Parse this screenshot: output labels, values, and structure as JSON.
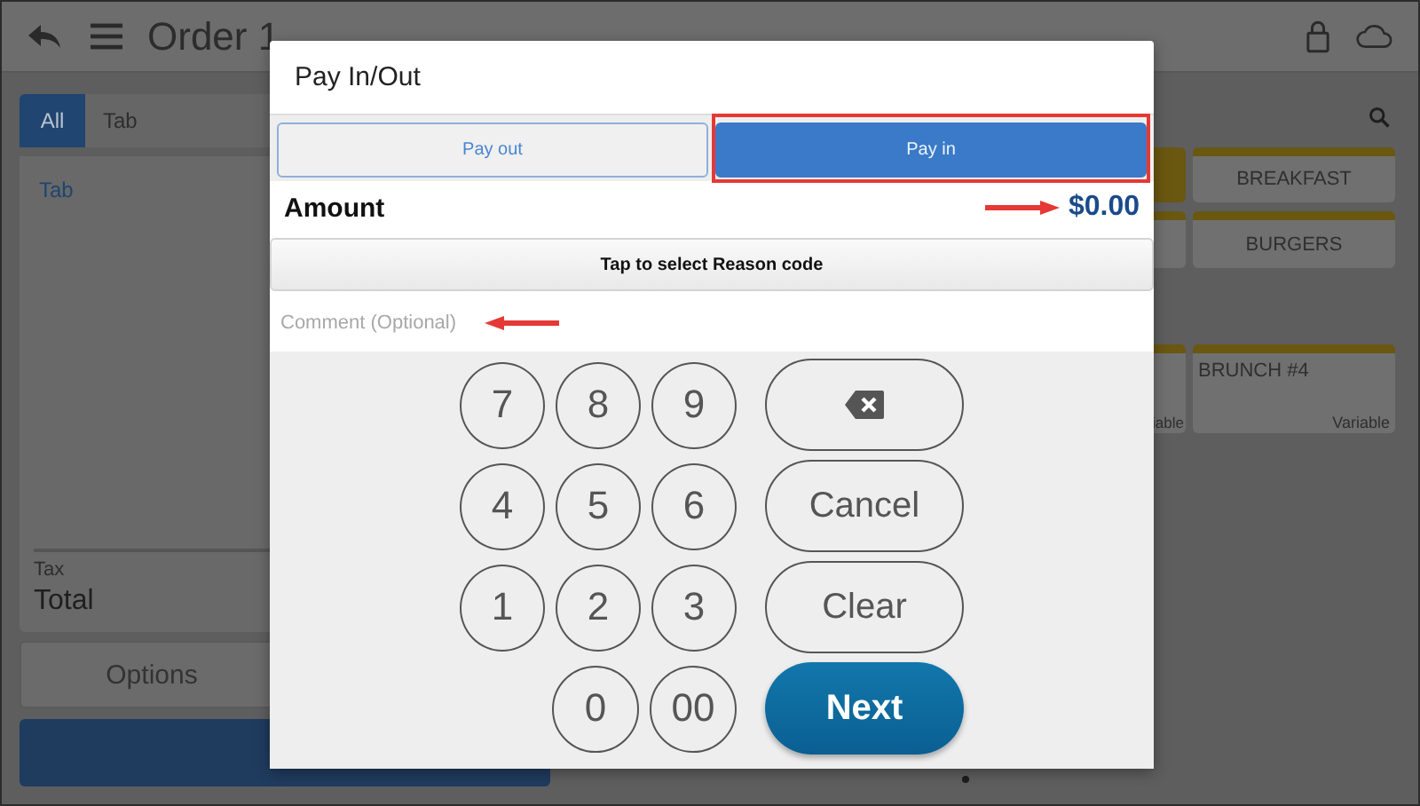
{
  "header": {
    "title": "Order 1"
  },
  "order_panel": {
    "tabs": [
      {
        "label": "All",
        "selected": true
      },
      {
        "label": "Tab",
        "selected": false
      }
    ],
    "items": [
      "Tab"
    ],
    "tax_label": "Tax",
    "total_label": "Total",
    "options_button": "Options"
  },
  "menu_tiles": [
    {
      "kind": "category",
      "selected": true
    },
    {
      "kind": "category",
      "label": "BREAKFAST",
      "selected": false
    },
    {
      "kind": "category",
      "selected": false
    },
    {
      "kind": "category",
      "label": "BURGERS",
      "selected": false
    },
    {
      "kind": "item",
      "price_note": "iable"
    },
    {
      "kind": "item",
      "label": "BRUNCH #4",
      "price_note": "Variable"
    }
  ],
  "dialog": {
    "title": "Pay In/Out",
    "modes": [
      {
        "label": "Pay out",
        "selected": false,
        "highlighted": false
      },
      {
        "label": "Pay in",
        "selected": true,
        "highlighted": true
      }
    ],
    "amount_label": "Amount",
    "amount": "$0.00",
    "amount_arrow": true,
    "reason_button": "Tap to select Reason code",
    "comment": {
      "placeholder": "Comment (Optional)",
      "arrow": true
    },
    "keypad_rows": [
      [
        "7",
        "8",
        "9"
      ],
      [
        "4",
        "5",
        "6"
      ],
      [
        "1",
        "2",
        "3"
      ],
      [
        "0",
        "00"
      ]
    ],
    "actions": [
      {
        "kind": "backspace"
      },
      {
        "kind": "text",
        "label": "Cancel"
      },
      {
        "kind": "text",
        "label": "Clear"
      },
      {
        "kind": "primary",
        "label": "Next"
      }
    ]
  }
}
